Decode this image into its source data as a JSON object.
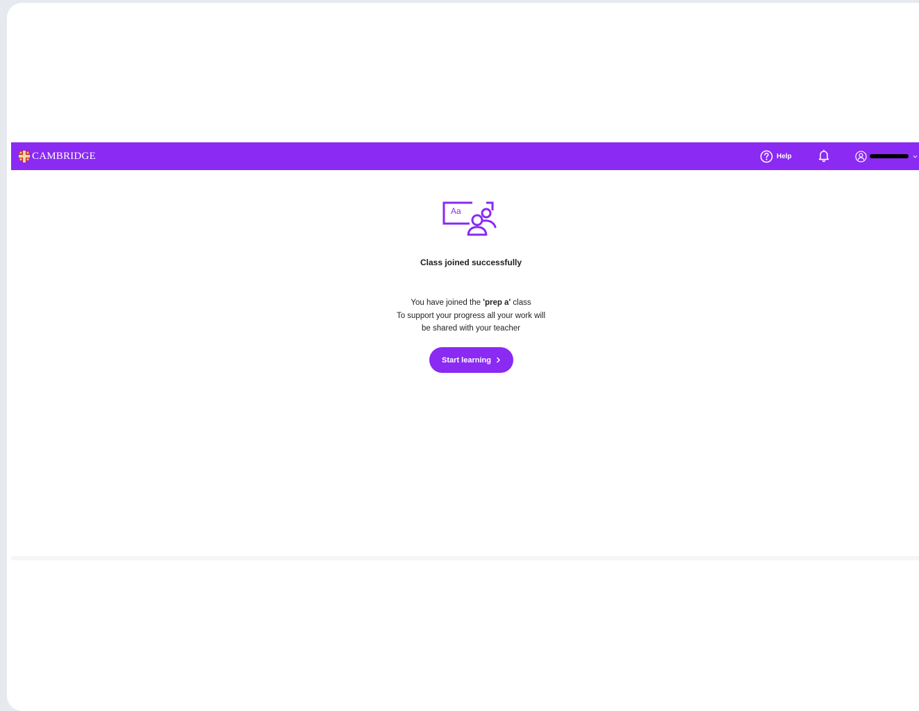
{
  "header": {
    "brand": "CAMBRIDGE",
    "help_label": "Help"
  },
  "main": {
    "title": "Class joined successfully",
    "message_prefix": "You have joined the ",
    "class_name": "'prep a'",
    "message_suffix": " class",
    "message_line2": "To support your progress all your work will",
    "message_line3": "be shared with your teacher",
    "start_label": "Start learning"
  },
  "icons": {
    "brand": "cambridge-shield-icon",
    "help": "question-circle-icon",
    "notifications": "bell-icon",
    "user": "user-circle-icon",
    "user_menu": "chevron-down-icon",
    "illustration": "class-board-icon",
    "start": "chevron-right-icon"
  },
  "colors": {
    "accent": "#8a2af2",
    "text": "#1c1c1c",
    "background": "#ffffff"
  }
}
